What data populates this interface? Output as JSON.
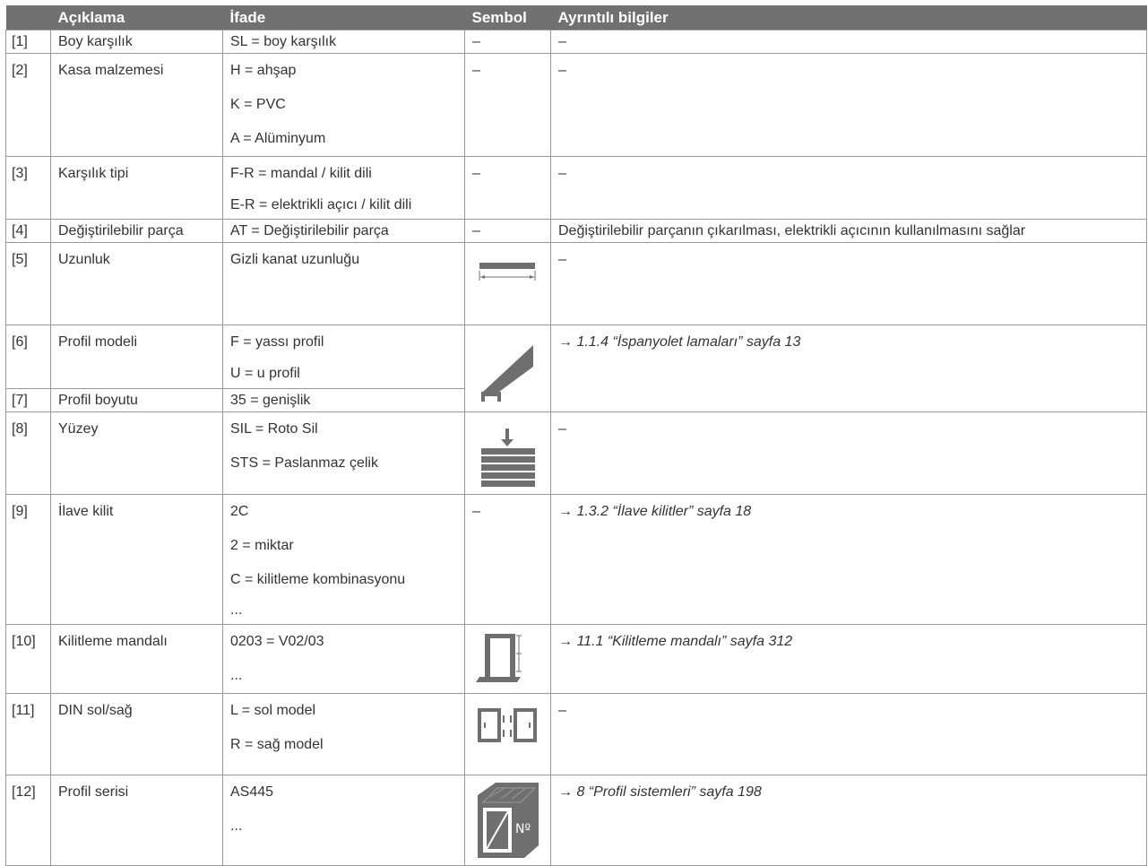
{
  "headers": {
    "num": "",
    "aciklama": "Açıklama",
    "ifade": "İfade",
    "sembol": "Sembol",
    "ayrintili": "Ayrıntılı bilgiler"
  },
  "rows": [
    {
      "num": "[1]",
      "desc": "Boy karşılık",
      "expr": [
        "SL = boy karşılık"
      ],
      "sym": "–",
      "info": "–"
    },
    {
      "num": "[2]",
      "desc": "Kasa malzemesi",
      "expr": [
        "H = ahşap",
        "K = PVC",
        "A = Alüminyum"
      ],
      "sym": "–",
      "info": "–"
    },
    {
      "num": "[3]",
      "desc": "Karşılık tipi",
      "expr": [
        "F-R = mandal / kilit dili",
        "E-R = elektrikli açıcı / kilit dili"
      ],
      "sym": "–",
      "info": "–"
    },
    {
      "num": "[4]",
      "desc": "Değiştirilebilir parça",
      "expr": [
        "AT = Değiştirilebilir parça"
      ],
      "sym": "–",
      "info": "Değiştirilebilir parçanın çıkarılması, elektrikli açıcının kullanılmasını sağlar"
    },
    {
      "num": "[5]",
      "desc": "Uzunluk",
      "expr": [
        "Gizli kanat uzunluğu"
      ],
      "sym_icon": "length-symbol-icon",
      "info": "–"
    },
    {
      "num": "[6]",
      "desc": "Profil modeli",
      "expr": [
        "F = yassı profil",
        "U = u profil"
      ],
      "sym_icon": "profile-symbol-icon",
      "info": "→ 1.1.4 “İspanyolet lamaları” sayfa 13"
    },
    {
      "num": "[7]",
      "desc": "Profil boyutu",
      "expr": [
        "35 = genişlik"
      ]
    },
    {
      "num": "[8]",
      "desc": "Yüzey",
      "expr": [
        "SIL = Roto Sil",
        "STS = Paslanmaz çelik"
      ],
      "sym_icon": "surface-symbol-icon",
      "info": "–"
    },
    {
      "num": "[9]",
      "desc": "İlave kilit",
      "expr": [
        "2C",
        "2 = miktar",
        "C = kilitleme kombinasyonu",
        "..."
      ],
      "sym": "–",
      "info": "→ 1.3.2 “İlave kilitler” sayfa 18"
    },
    {
      "num": "[10]",
      "desc": "Kilitleme mandalı",
      "expr": [
        "0203 = V02/03",
        "..."
      ],
      "sym_icon": "locking-latch-symbol-icon",
      "info": "→ 11.1 “Kilitleme mandalı” sayfa 312"
    },
    {
      "num": "[11]",
      "desc": "DIN sol/sağ",
      "expr": [
        "L = sol model",
        "R = sağ model"
      ],
      "sym_icon": "din-left-right-symbol-icon",
      "info": "–"
    },
    {
      "num": "[12]",
      "desc": "Profil serisi",
      "expr": [
        "AS445",
        "..."
      ],
      "sym_icon": "profile-series-symbol-icon",
      "info": "→ 8 “Profil sistemleri” sayfa 198"
    }
  ]
}
